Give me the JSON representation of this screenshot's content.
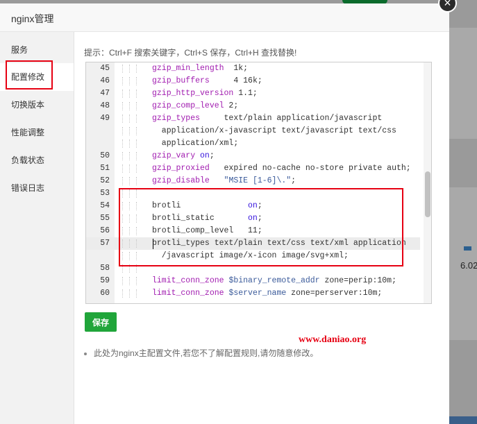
{
  "modal": {
    "title": "nginx管理",
    "close_icon": "close-icon"
  },
  "sidebar": {
    "items": [
      {
        "label": "服务"
      },
      {
        "label": "配置修改"
      },
      {
        "label": "切换版本"
      },
      {
        "label": "性能调整"
      },
      {
        "label": "负载状态"
      },
      {
        "label": "错误日志"
      }
    ],
    "active": "配置修改"
  },
  "hint": "提示：Ctrl+F 搜索关键字，Ctrl+S 保存，Ctrl+H 查找替换!",
  "editor": {
    "lines": [
      {
        "num": "45",
        "key": "gzip_min_length",
        "rest": "  1k;"
      },
      {
        "num": "46",
        "key": "gzip_buffers",
        "rest": "     4 16k;"
      },
      {
        "num": "47",
        "key": "gzip_http_version",
        "rest": " 1.1;"
      },
      {
        "num": "48",
        "key": "gzip_comp_level",
        "rest": " 2;"
      },
      {
        "num": "49",
        "key": "gzip_types",
        "rest": "     text/plain application/javascript"
      },
      {
        "num": "",
        "key": "",
        "rest": "  application/x-javascript text/javascript text/css"
      },
      {
        "num": "",
        "key": "",
        "rest": "  application/xml;"
      },
      {
        "num": "50",
        "key": "gzip_vary",
        "rest": " on;"
      },
      {
        "num": "51",
        "key": "gzip_proxied",
        "rest": "   expired no-cache no-store private auth;"
      },
      {
        "num": "52",
        "key": "gzip_disable",
        "rest": "   \"MSIE [1-6]\\.\";"
      },
      {
        "num": "53",
        "key": "",
        "rest": ""
      },
      {
        "num": "54",
        "key": "",
        "rest": "brotli              on;"
      },
      {
        "num": "55",
        "key": "",
        "rest": "brotli_static       on;"
      },
      {
        "num": "56",
        "key": "",
        "rest": "brotli_comp_level   11;"
      },
      {
        "num": "57",
        "key": "",
        "rest": "brotli_types text/plain text/css text/xml application"
      },
      {
        "num": "",
        "key": "",
        "rest": "  /javascript image/x-icon image/svg+xml;"
      },
      {
        "num": "58",
        "key": "",
        "rest": ""
      },
      {
        "num": "59",
        "key": "limit_conn_zone",
        "rest": " $binary_remote_addr zone=perip:10m;"
      },
      {
        "num": "60",
        "key": "limit_conn_zone",
        "rest": " $server_name zone=perserver:10m;"
      }
    ]
  },
  "save_button": "保存",
  "note": "此处为nginx主配置文件,若您不了解配置规则,请勿随意修改。",
  "watermark": "www.daniao.org",
  "background": {
    "number": "6.02"
  },
  "colors": {
    "accent_green": "#20a53a",
    "highlight_red": "#e60012",
    "keyword": "#a11cb0"
  }
}
